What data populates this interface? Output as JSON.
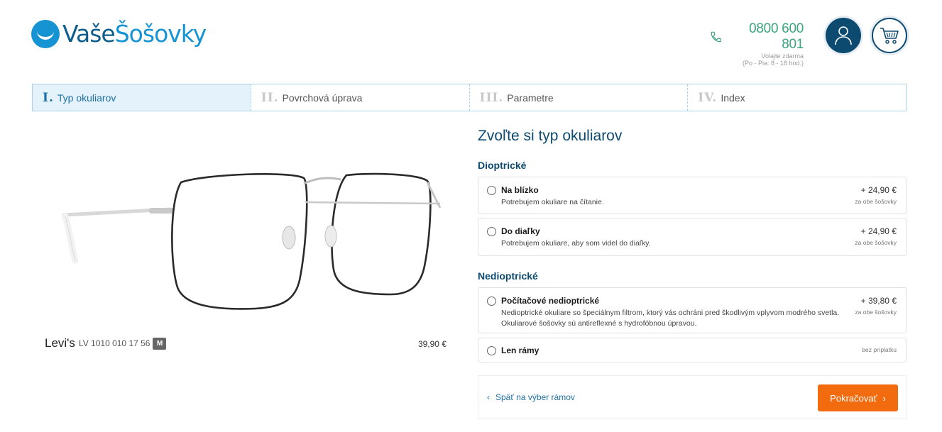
{
  "header": {
    "logo_part1": "Vaše",
    "logo_part2": "Šošovky",
    "phone_number": "0800 600 801",
    "phone_note1": "Volajte zdarma",
    "phone_note2": "(Po - Pia: 8 - 18 hod.)",
    "user_icon": "user-icon",
    "cart_icon": "cart-icon"
  },
  "steps": [
    {
      "numeral": "I.",
      "label": "Typ okuliarov",
      "active": true
    },
    {
      "numeral": "II.",
      "label": "Povrchová úprava",
      "active": false
    },
    {
      "numeral": "III.",
      "label": "Parametre",
      "active": false
    },
    {
      "numeral": "IV.",
      "label": "Index",
      "active": false
    }
  ],
  "product": {
    "brand": "Levi's",
    "model": "LV 1010 010 17 56",
    "size": "M",
    "price": "39,90 €"
  },
  "panel": {
    "title": "Zvoľte si typ okuliarov",
    "section_prescription": "Dioptrické",
    "section_nonprescription": "Nedioptrické",
    "options": [
      {
        "label": "Na blízko",
        "desc": "Potrebujem okuliare na čítanie.",
        "price": "+ 24,90 €",
        "note": "za obe šošovky"
      },
      {
        "label": "Do diaľky",
        "desc": "Potrebujem okuliare, aby som videl do diaľky.",
        "price": "+ 24,90 €",
        "note": "za obe šošovky"
      },
      {
        "label": "Počítačové nedioptrické",
        "desc": "Nedioptrické okuliare so špeciálnym filtrom, ktorý vás ochráni pred škodlivým vplyvom modrého svetla. Okuliarové šošovky sú antireflexné s hydrofóbnou úpravou.",
        "price": "+ 39,80 €",
        "note": "za obe šošovky"
      },
      {
        "label": "Len rámy",
        "desc": "",
        "price": "",
        "note": "bez príplatku"
      }
    ]
  },
  "actions": {
    "back_label": "Späť na výber rámov",
    "continue_label": "Pokračovať"
  },
  "colors": {
    "brand_dark": "#0d4a70",
    "brand_light": "#1593d2",
    "phone_green": "#3ba57e",
    "cta_orange": "#f26b0f"
  }
}
